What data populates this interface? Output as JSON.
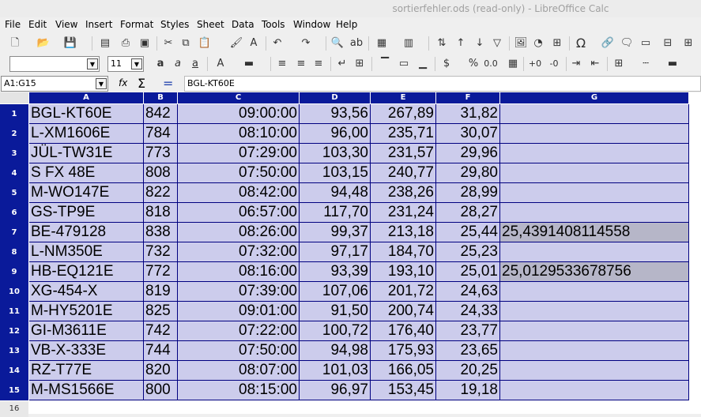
{
  "window": {
    "title": "sortierfehler.ods (read-only) - LibreOffice Calc"
  },
  "menu": [
    "File",
    "Edit",
    "View",
    "Insert",
    "Format",
    "Styles",
    "Sheet",
    "Data",
    "Tools",
    "Window",
    "Help"
  ],
  "format_bar": {
    "font_name": "",
    "font_size": "11"
  },
  "formula_bar": {
    "name_box": "A1:G15",
    "content": "BGL-KT60E"
  },
  "columns": [
    "A",
    "B",
    "C",
    "D",
    "E",
    "F",
    "G"
  ],
  "rows": [
    {
      "n": "1",
      "a": "BGL-KT60E",
      "b": "842",
      "c": "09:00:00",
      "d": "93,56",
      "e": "267,89",
      "f": "31,82",
      "g": ""
    },
    {
      "n": "2",
      "a": "L-XM1606E",
      "b": "784",
      "c": "08:10:00",
      "d": "96,00",
      "e": "235,71",
      "f": "30,07",
      "g": ""
    },
    {
      "n": "3",
      "a": "JÜL-TW31E",
      "b": "773",
      "c": "07:29:00",
      "d": "103,30",
      "e": "231,57",
      "f": "29,96",
      "g": ""
    },
    {
      "n": "4",
      "a": "S FX 48E",
      "b": "808",
      "c": "07:50:00",
      "d": "103,15",
      "e": "240,77",
      "f": "29,80",
      "g": ""
    },
    {
      "n": "5",
      "a": "M-WO147E",
      "b": "822",
      "c": "08:42:00",
      "d": "94,48",
      "e": "238,26",
      "f": "28,99",
      "g": ""
    },
    {
      "n": "6",
      "a": "GS-TP9E",
      "b": "818",
      "c": "06:57:00",
      "d": "117,70",
      "e": "231,24",
      "f": "28,27",
      "g": ""
    },
    {
      "n": "7",
      "a": "BE-479128",
      "b": "838",
      "c": "08:26:00",
      "d": "99,37",
      "e": "213,18",
      "f": "25,44",
      "g": "25,4391408114558"
    },
    {
      "n": "8",
      "a": "L-NM350E",
      "b": "732",
      "c": "07:32:00",
      "d": "97,17",
      "e": "184,70",
      "f": "25,23",
      "g": ""
    },
    {
      "n": "9",
      "a": "HB-EQ121E",
      "b": "772",
      "c": "08:16:00",
      "d": "93,39",
      "e": "193,10",
      "f": "25,01",
      "g": "25,0129533678756"
    },
    {
      "n": "10",
      "a": "XG-454-X",
      "b": "819",
      "c": "07:39:00",
      "d": "107,06",
      "e": "201,72",
      "f": "24,63",
      "g": ""
    },
    {
      "n": "11",
      "a": "M-HY5201E",
      "b": "825",
      "c": "09:01:00",
      "d": "91,50",
      "e": "200,74",
      "f": "24,33",
      "g": ""
    },
    {
      "n": "12",
      "a": "GI-M3611E",
      "b": "742",
      "c": "07:22:00",
      "d": "100,72",
      "e": "176,40",
      "f": "23,77",
      "g": ""
    },
    {
      "n": "13",
      "a": "VB-X-333E",
      "b": "744",
      "c": "07:50:00",
      "d": "94,98",
      "e": "175,93",
      "f": "23,65",
      "g": ""
    },
    {
      "n": "14",
      "a": "RZ-T77E",
      "b": "820",
      "c": "08:07:00",
      "d": "101,03",
      "e": "166,05",
      "f": "20,25",
      "g": ""
    },
    {
      "n": "15",
      "a": "M-MS1566E",
      "b": "800",
      "c": "08:15:00",
      "d": "96,97",
      "e": "153,45",
      "f": "19,18",
      "g": ""
    }
  ],
  "extra_row": "16",
  "colors": {
    "header_blue": "#0a1a9a",
    "selection": "#ccccec",
    "highlight": "#b6b6c8"
  }
}
